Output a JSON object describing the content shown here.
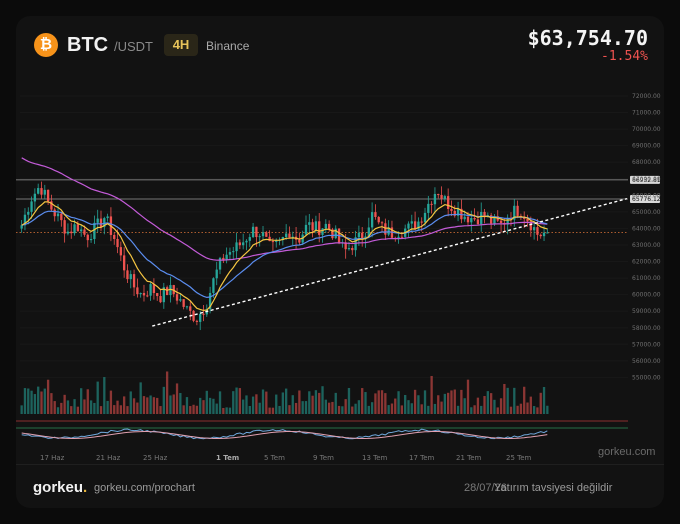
{
  "header": {
    "logo_glyph": "₿",
    "logo_icon": "bitcoin-icon",
    "symbol": "BTC",
    "pair": "/USDT",
    "timeframe": "4H",
    "exchange": "Binance",
    "price": "$63,754.70",
    "change": "-1.54%"
  },
  "colors": {
    "bull": "#26a69a",
    "bear": "#ef5350",
    "ema_fast": "#f5c542",
    "ema_mid": "#5b8def",
    "ema_slow": "#c35bd8",
    "accent": "#e8b53c"
  },
  "chart_data": {
    "type": "candlestick",
    "y_ticks": [
      "72000.00",
      "71000.00",
      "70000.00",
      "69000.00",
      "68000.00",
      "67000.00",
      "66000.00",
      "65000.00",
      "64000.00",
      "63000.00",
      "62000.00",
      "61000.00",
      "60000.00",
      "59000.00",
      "58000.00",
      "57000.00",
      "56000.00",
      "55000.00"
    ],
    "ylim": [
      54300,
      72000
    ],
    "x_ticks": [
      "17 Haz",
      "21 Haz",
      "25 Haz",
      "1 Tem",
      "5 Tem",
      "9 Tem",
      "13 Tem",
      "17 Tem",
      "21 Tem",
      "25 Tem"
    ],
    "levels": [
      {
        "label": "66932.81",
        "value": 66932.81
      },
      {
        "label": "65776.12",
        "value": 65776.12
      }
    ],
    "close_level": 63754.7,
    "trendline": {
      "from": [
        0.25,
        58100
      ],
      "to": [
        1.0,
        65800
      ]
    },
    "close_path": [
      [
        0.0,
        64200
      ],
      [
        0.02,
        65800
      ],
      [
        0.04,
        66600
      ],
      [
        0.06,
        65400
      ],
      [
        0.08,
        64600
      ],
      [
        0.1,
        63800
      ],
      [
        0.12,
        64200
      ],
      [
        0.14,
        63500
      ],
      [
        0.16,
        64000
      ],
      [
        0.18,
        64700
      ],
      [
        0.2,
        63500
      ],
      [
        0.22,
        61800
      ],
      [
        0.24,
        60600
      ],
      [
        0.26,
        60000
      ],
      [
        0.28,
        60400
      ],
      [
        0.3,
        59900
      ],
      [
        0.32,
        60300
      ],
      [
        0.34,
        59800
      ],
      [
        0.36,
        59000
      ],
      [
        0.38,
        58600
      ],
      [
        0.4,
        59400
      ],
      [
        0.42,
        61200
      ],
      [
        0.44,
        62400
      ],
      [
        0.46,
        62700
      ],
      [
        0.48,
        63200
      ],
      [
        0.5,
        63900
      ],
      [
        0.52,
        63700
      ],
      [
        0.54,
        62700
      ],
      [
        0.56,
        63100
      ],
      [
        0.58,
        63900
      ],
      [
        0.6,
        63300
      ],
      [
        0.62,
        64200
      ],
      [
        0.64,
        64000
      ],
      [
        0.66,
        64200
      ],
      [
        0.68,
        63600
      ],
      [
        0.7,
        62600
      ],
      [
        0.72,
        63100
      ],
      [
        0.74,
        63600
      ],
      [
        0.76,
        64800
      ],
      [
        0.78,
        64000
      ],
      [
        0.8,
        63700
      ],
      [
        0.82,
        63900
      ],
      [
        0.84,
        64000
      ],
      [
        0.86,
        64400
      ],
      [
        0.88,
        65400
      ],
      [
        0.9,
        66400
      ],
      [
        0.92,
        65600
      ],
      [
        0.94,
        65200
      ],
      [
        0.96,
        64800
      ],
      [
        0.98,
        64600
      ],
      [
        1.0,
        64800
      ],
      [
        1.02,
        64400
      ],
      [
        1.04,
        64200
      ],
      [
        1.06,
        64900
      ],
      [
        1.08,
        65200
      ],
      [
        1.1,
        64500
      ],
      [
        1.12,
        63600
      ],
      [
        1.14,
        63754
      ]
    ]
  },
  "footer": {
    "brand_main": "gorkeu",
    "brand_dot": ".",
    "url": "gorkeu.com/prochart",
    "date": "28/07/26",
    "disclaimer": "Yatırım tavsiyesi değildir",
    "watermark": "gorkeu.com"
  }
}
